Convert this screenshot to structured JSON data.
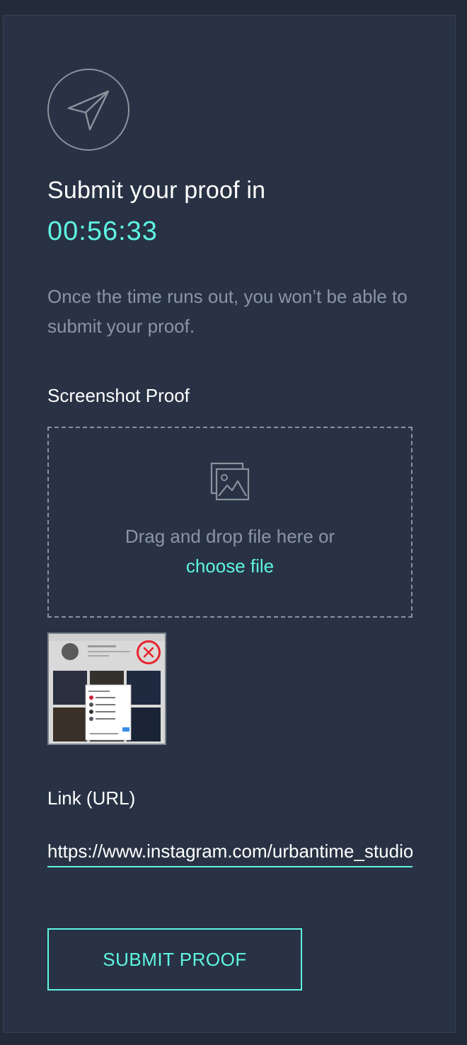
{
  "header": {
    "icon": "paper-plane-icon",
    "title": "Submit your proof in",
    "timer": "00:56:33",
    "warning": "Once the time runs out, you won’t be able to submit your proof."
  },
  "screenshot": {
    "label": "Screenshot Proof",
    "dropzone_icon": "image-icon",
    "drop_text": "Drag and drop file here or",
    "choose_link": "choose file",
    "remove_icon": "close-circle-icon"
  },
  "link": {
    "label": "Link (URL)",
    "value": "https://www.instagram.com/urbantime_studio"
  },
  "submit": {
    "label": "SUBMIT PROOF"
  },
  "colors": {
    "background": "#232b3a",
    "panel": "#283244",
    "accent": "#5ff5e3",
    "muted_text": "#8b95a2",
    "danger": "#e8232c"
  }
}
